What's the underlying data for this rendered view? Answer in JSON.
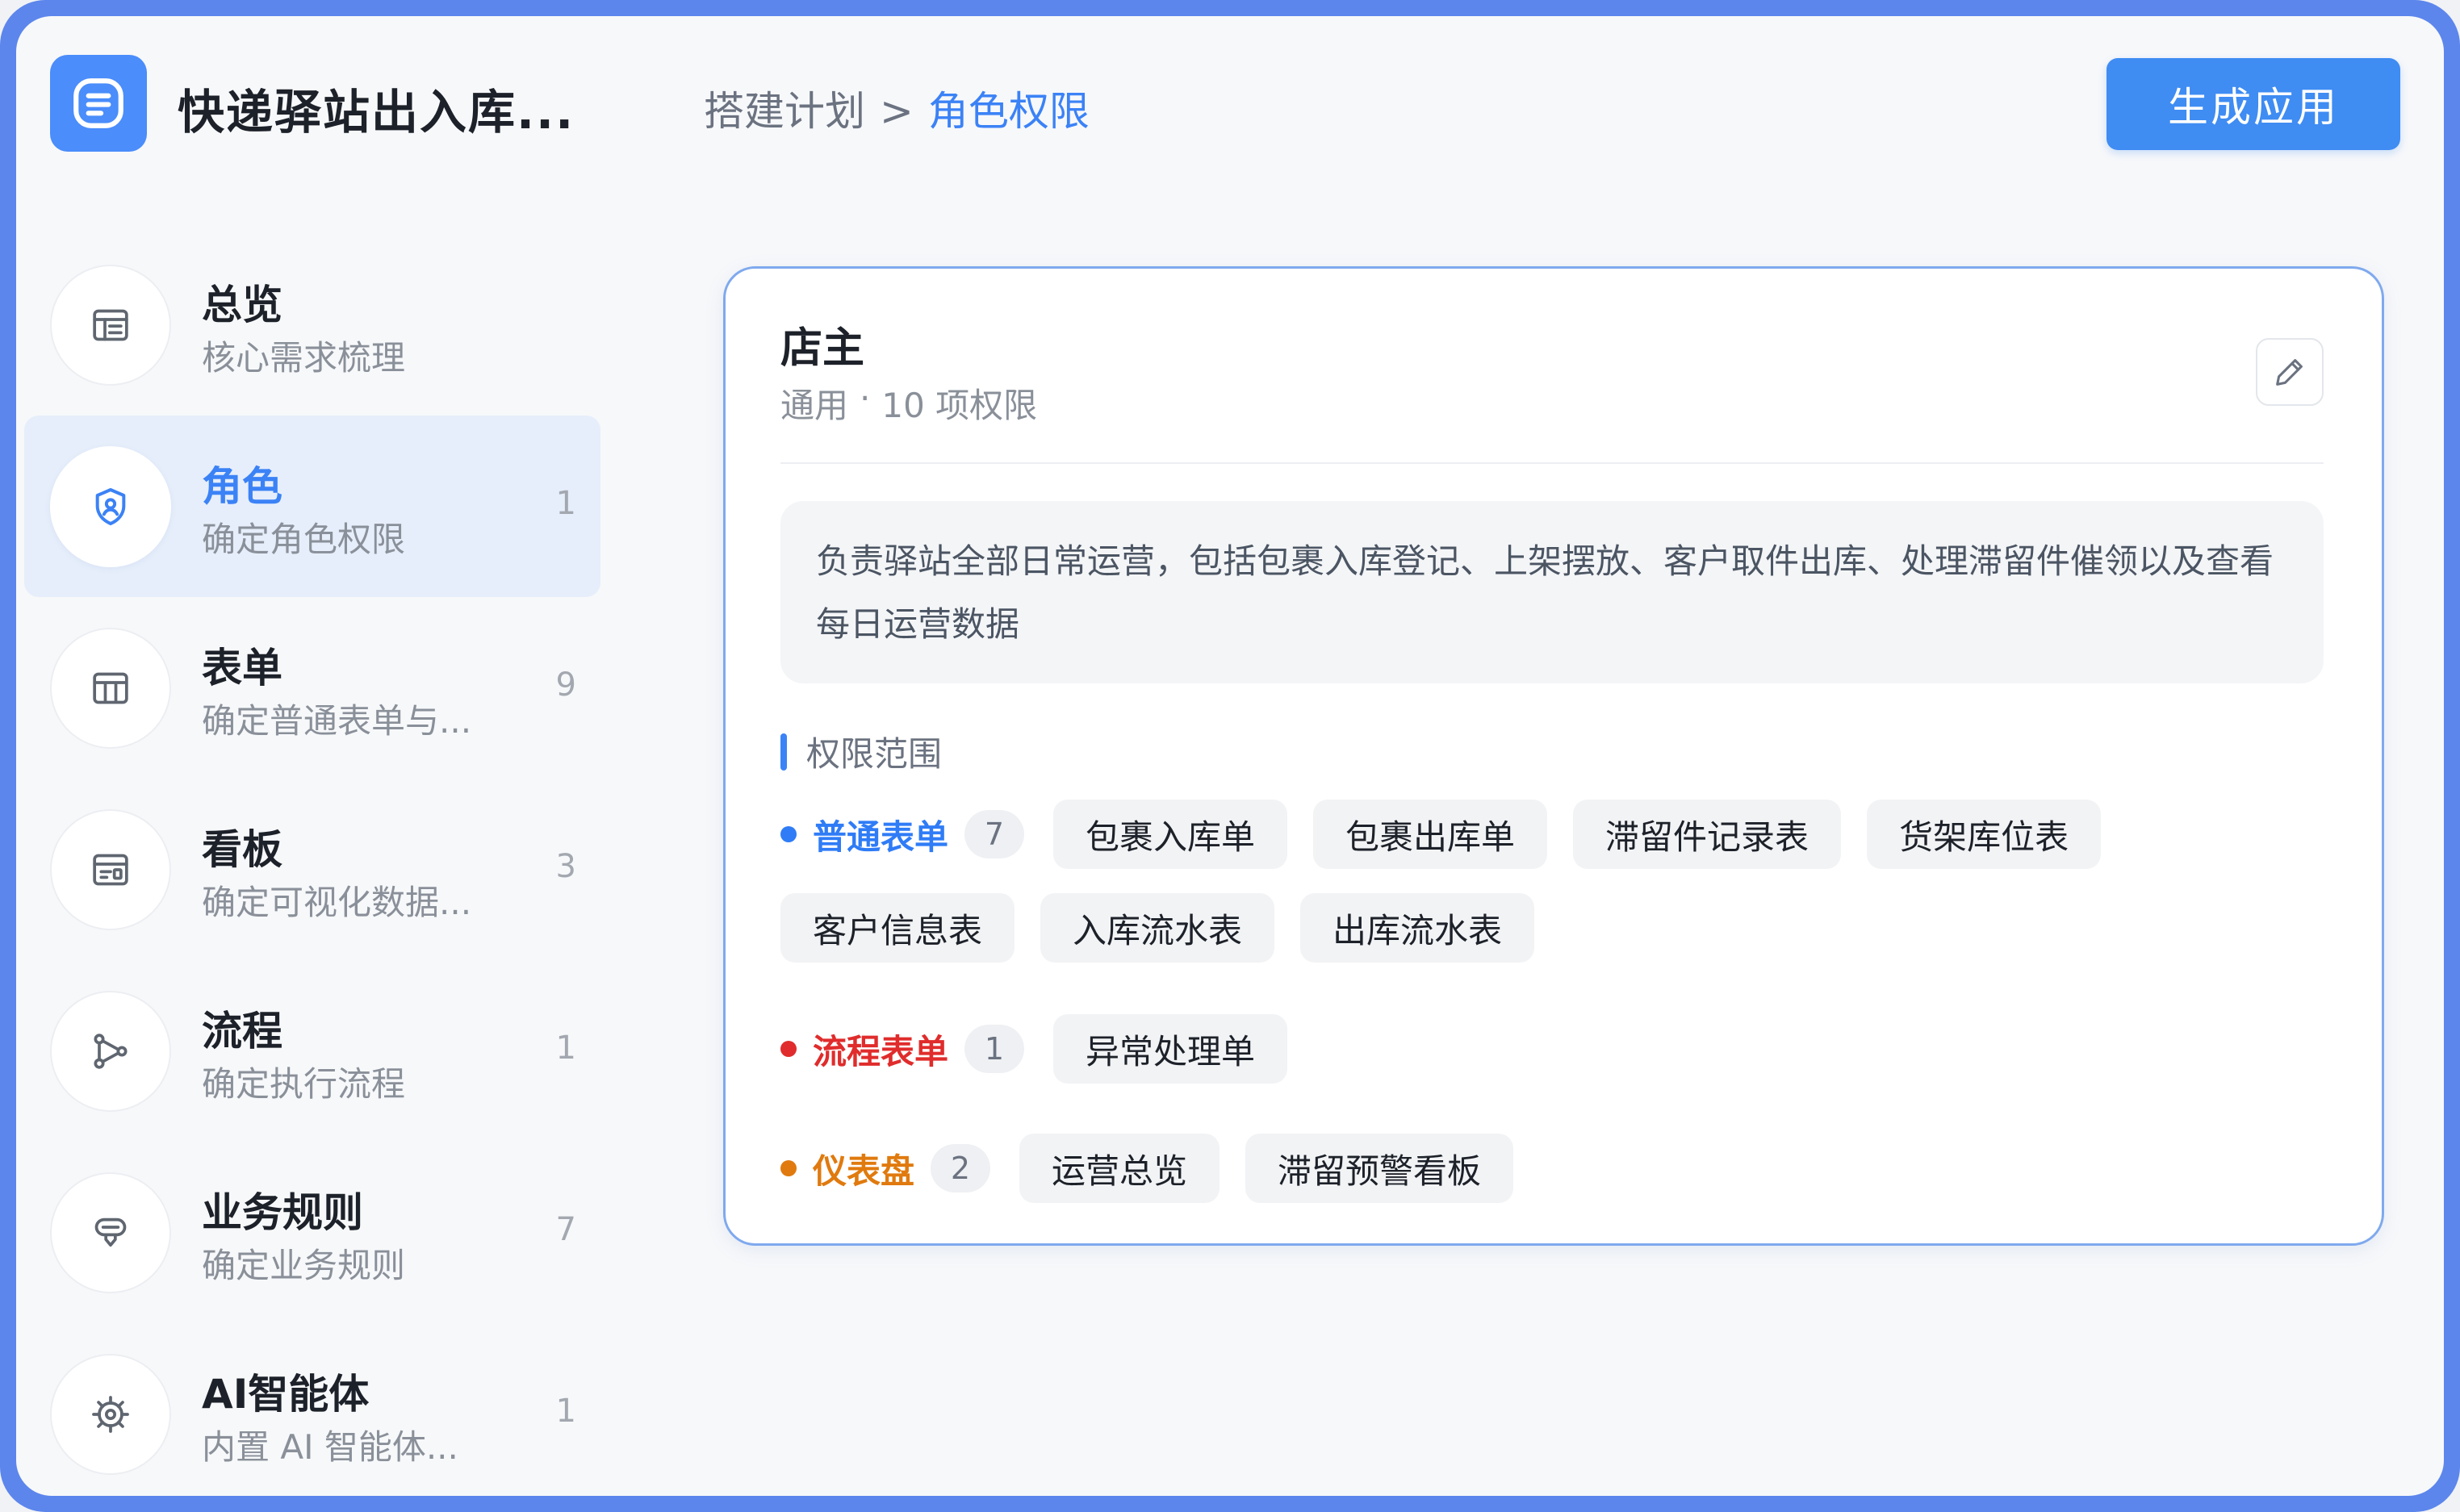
{
  "header": {
    "app_title": "快递驿站出入库...",
    "breadcrumb": {
      "parent": "搭建计划",
      "separator": ">",
      "current": "角色权限"
    },
    "generate_button": "生成应用"
  },
  "sidebar": {
    "items": [
      {
        "title": "总览",
        "subtitle": "核心需求梳理",
        "count": "",
        "icon": "overview-icon"
      },
      {
        "title": "角色",
        "subtitle": "确定角色权限",
        "count": "1",
        "icon": "shield-user-icon",
        "active": true
      },
      {
        "title": "表单",
        "subtitle": "确定普通表单与...",
        "count": "9",
        "icon": "table-icon"
      },
      {
        "title": "看板",
        "subtitle": "确定可视化数据...",
        "count": "3",
        "icon": "dashboard-icon"
      },
      {
        "title": "流程",
        "subtitle": "确定执行流程",
        "count": "1",
        "icon": "flow-icon"
      },
      {
        "title": "业务规则",
        "subtitle": "确定业务规则",
        "count": "7",
        "icon": "rule-icon"
      },
      {
        "title": "AI智能体",
        "subtitle": "内置 AI 智能体...",
        "count": "1",
        "icon": "ai-agent-icon"
      }
    ]
  },
  "role_card": {
    "name": "店主",
    "scope": "通用",
    "meta_separator": "·",
    "permission_count": "10 项权限",
    "description": "负责驿站全部日常运营，包括包裹入库登记、上架摆放、客户取件出库、处理滞留件催领以及查看每日运营数据",
    "section_title": "权限范围",
    "groups": [
      {
        "label": "普通表单",
        "count": "7",
        "color": "#2f7cf6",
        "items": [
          "包裹入库单",
          "包裹出库单",
          "滞留件记录表",
          "货架库位表",
          "客户信息表",
          "入库流水表",
          "出库流水表"
        ]
      },
      {
        "label": "流程表单",
        "count": "1",
        "color": "#e02c2c",
        "items": [
          "异常处理单"
        ]
      },
      {
        "label": "仪表盘",
        "count": "2",
        "color": "#e07a0e",
        "items": [
          "运营总览",
          "滞留预警看板"
        ]
      }
    ]
  },
  "colors": {
    "accent": "#3b82f6",
    "card_border": "#7fa9ee",
    "frame": "#5c86ec"
  }
}
